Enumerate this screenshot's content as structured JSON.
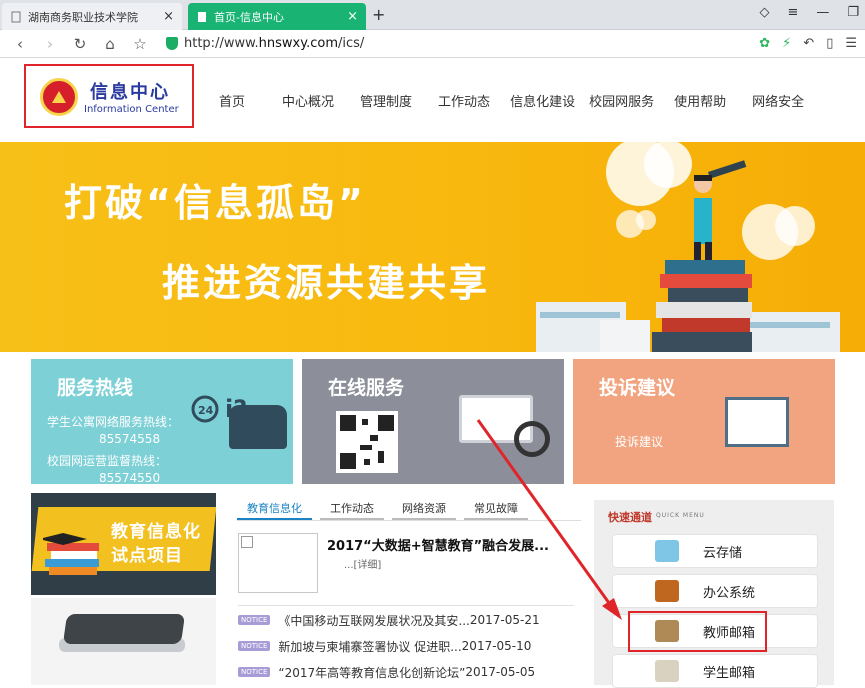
{
  "browser": {
    "tabs": [
      {
        "label": "湖南商务职业技术学院",
        "active": false
      },
      {
        "label": "首页-信息中心",
        "active": true
      }
    ],
    "new_tab": "+",
    "url_prefix": "http://www.",
    "url_domain": "hnswxy.com",
    "url_path": "/ics/"
  },
  "header": {
    "logo_cn": "信息中心",
    "logo_en": "Information Center",
    "menu": [
      "首页",
      "中心概况",
      "管理制度",
      "工作动态",
      "信息化建设",
      "校园网服务",
      "使用帮助",
      "网络安全"
    ]
  },
  "banner": {
    "line1": "打破“信息孤岛”",
    "line2": "推进资源共建共享"
  },
  "cards": {
    "hotline": {
      "title": "服务热线",
      "line1": "学生公寓网络服务热线：",
      "num1": "85574558",
      "line2": "校园网运营监督热线：",
      "num2": "85574550"
    },
    "online": {
      "title": "在线服务"
    },
    "complaint": {
      "title": "投诉建议",
      "sub": "投诉建议"
    }
  },
  "edu": {
    "line1": "教育信息化",
    "line2": "试点项目"
  },
  "news": {
    "tabs": [
      "教育信息化",
      "工作动态",
      "网络资源",
      "常见故障"
    ],
    "featured_title": "2017“大数据+智慧教育”融合发展...",
    "featured_more": "...[详细]",
    "badge": "NOTICE",
    "items": [
      {
        "title": "《中国移动互联网发展状况及其安...",
        "date": "2017-05-21"
      },
      {
        "title": "新加坡与柬埔寨签署协议 促进职...",
        "date": "2017-05-10"
      },
      {
        "title": "“2017年高等教育信息化创新论坛”",
        "date": "2017-05-05"
      }
    ]
  },
  "quick": {
    "title": "快速通道",
    "subtitle": "QUICK MENU",
    "items": [
      "云存储",
      "办公系统",
      "教师邮箱",
      "学生邮箱"
    ]
  },
  "colors": {
    "accent": "#19b473",
    "highlight": "#e0252a",
    "banner": "#f7b80f"
  }
}
